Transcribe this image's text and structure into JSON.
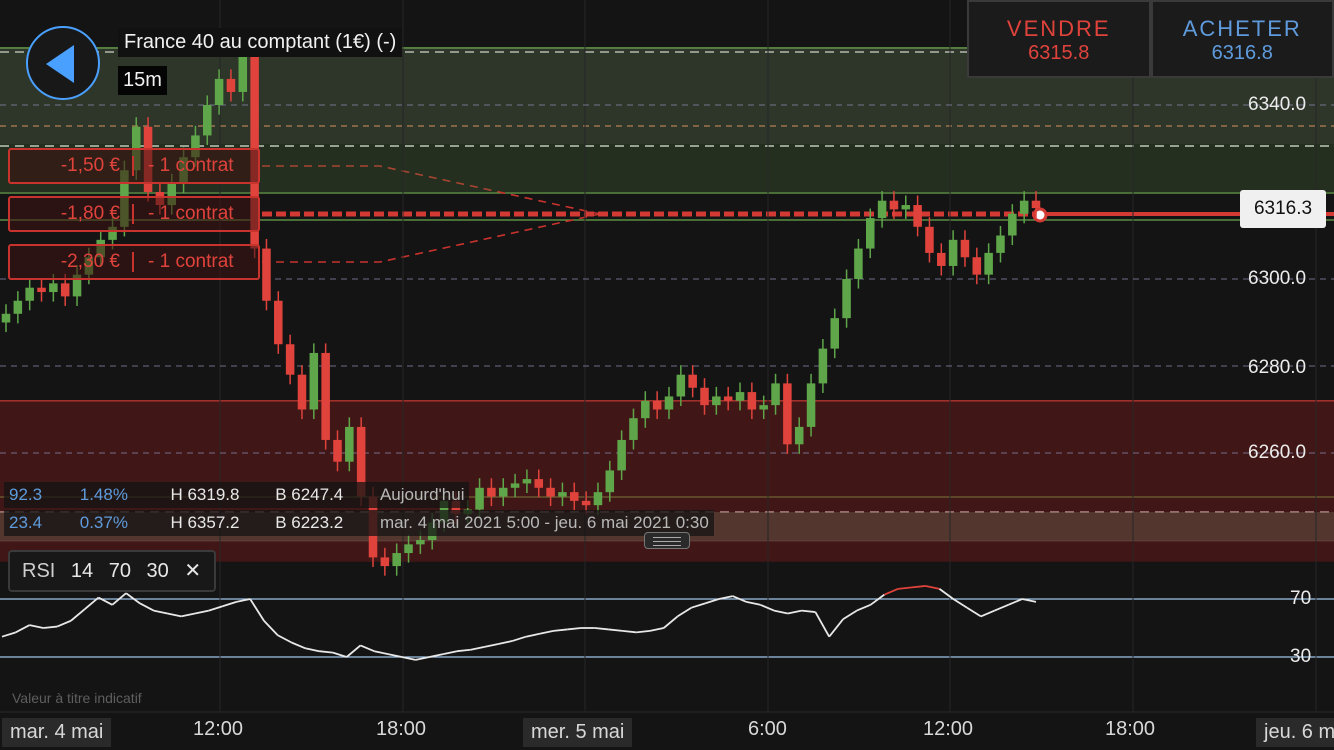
{
  "instrument": {
    "title": "France 40 au comptant (1€) (-)",
    "timeframe": "15m"
  },
  "trade": {
    "sell_label": "VENDRE",
    "sell_price": "6315.8",
    "buy_label": "ACHETER",
    "buy_price": "6316.8"
  },
  "current_price": "6316.3",
  "orders": [
    {
      "amount": "-1,50 €",
      "qty": "- 1 contrat"
    },
    {
      "amount": "-1,80 €",
      "qty": "- 1 contrat"
    },
    {
      "amount": "-2,30 €",
      "qty": "- 1 contrat"
    }
  ],
  "stats": [
    {
      "a": "92.3",
      "b": "1.48%",
      "h": "H 6319.8",
      "l": "B 6247.4",
      "period": "Aujourd'hui"
    },
    {
      "a": "23.4",
      "b": "0.37%",
      "h": "H 6357.2",
      "l": "B 6223.2",
      "period": "mar. 4 mai 2021 5:00 - jeu. 6 mai 2021 0:30"
    }
  ],
  "rsi": {
    "name": "RSI",
    "period": "14",
    "upper": "70",
    "lower": "30",
    "close_glyph": "✕"
  },
  "disclaimer": "Valeur à titre indicatif",
  "colors": {
    "up": "#5fa64a",
    "down": "#e0433c",
    "rsi_line": "#e8e8e8",
    "rsi_level": "#9fc4ec"
  },
  "chart_data": [
    {
      "type": "candlestick",
      "title": "France 40 au comptant (1€) (-)",
      "price_ticks": [
        "6340.0",
        "6300.0",
        "6280.0",
        "6260.0"
      ],
      "price_tick_values": [
        6340,
        6300,
        6280,
        6260
      ],
      "x_labels": [
        "mar. 4 mai",
        "12:00",
        "18:00",
        "mer. 5 mai",
        "6:00",
        "12:00",
        "18:00",
        "jeu. 6 m"
      ],
      "x_day_labels": [
        true,
        false,
        false,
        true,
        false,
        false,
        false,
        false
      ],
      "zones": [
        {
          "from": 6320,
          "to": 6331,
          "kind": "resistance"
        },
        {
          "from": 6235,
          "to": 6272,
          "kind": "support"
        }
      ],
      "current_price": 6316.3,
      "closes": [
        6292,
        6295,
        6298,
        6297,
        6299,
        6296,
        6301,
        6305,
        6309,
        6312,
        6325,
        6335,
        6320,
        6317,
        6322,
        6328,
        6333,
        6340,
        6346,
        6343,
        6352,
        6307,
        6295,
        6285,
        6278,
        6270,
        6283,
        6263,
        6258,
        6266,
        6250,
        6236,
        6234,
        6237,
        6239,
        6240,
        6244,
        6249,
        6246,
        6247,
        6252,
        6250,
        6252,
        6253,
        6254,
        6252,
        6250,
        6251,
        6249,
        6248,
        6251,
        6256,
        6263,
        6268,
        6272,
        6270,
        6273,
        6278,
        6275,
        6271,
        6273,
        6272,
        6274,
        6270,
        6271,
        6276,
        6262,
        6266,
        6276,
        6284,
        6291,
        6300,
        6307,
        6314,
        6318,
        6316,
        6317,
        6312,
        6306,
        6303,
        6309,
        6305,
        6301,
        6306,
        6310,
        6315,
        6318,
        6316.3
      ],
      "y_unit": "price"
    },
    {
      "type": "line",
      "title": "RSI 14",
      "levels": [
        70,
        30
      ],
      "level_labels": [
        "70",
        "30"
      ],
      "values": [
        44,
        47,
        52,
        50,
        51,
        55,
        63,
        71,
        66,
        74,
        67,
        62,
        60,
        58,
        60,
        62,
        65,
        68,
        70,
        55,
        45,
        40,
        36,
        34,
        33,
        30,
        38,
        34,
        32,
        30,
        28,
        30,
        32,
        34,
        35,
        37,
        39,
        41,
        44,
        46,
        48,
        49,
        50,
        50,
        49,
        48,
        47,
        48,
        50,
        58,
        64,
        67,
        70,
        72,
        68,
        66,
        62,
        60,
        62,
        61,
        44,
        56,
        62,
        66,
        73,
        77,
        78,
        79,
        77,
        70,
        64,
        58,
        62,
        66,
        70,
        68
      ],
      "ylim": [
        20,
        90
      ]
    }
  ]
}
